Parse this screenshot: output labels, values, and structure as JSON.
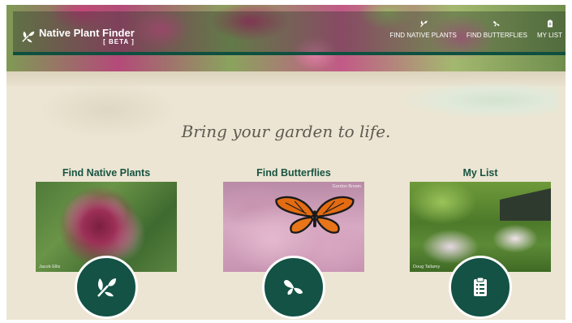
{
  "brand": {
    "title": "Native Plant Finder",
    "beta": "[ BETA ]"
  },
  "nav": {
    "items": [
      {
        "label": "FIND NATIVE PLANTS",
        "icon": "leaf-icon"
      },
      {
        "label": "FIND BUTTERFLIES",
        "icon": "butterfly-icon"
      },
      {
        "label": "MY LIST",
        "icon": "clipboard-icon"
      }
    ]
  },
  "tagline": "Bring your garden to life.",
  "cards": [
    {
      "title": "Find Native Plants",
      "credit": "Jacob Ellis",
      "icon": "leaf-icon"
    },
    {
      "title": "Find Butterflies",
      "credit": "Gordon Brown",
      "icon": "butterfly-icon"
    },
    {
      "title": "My List",
      "credit": "Doug Tallamy",
      "icon": "clipboard-icon"
    }
  ],
  "colors": {
    "accent_green": "#135244",
    "title_green": "#185442",
    "background": "#ece5d3"
  }
}
